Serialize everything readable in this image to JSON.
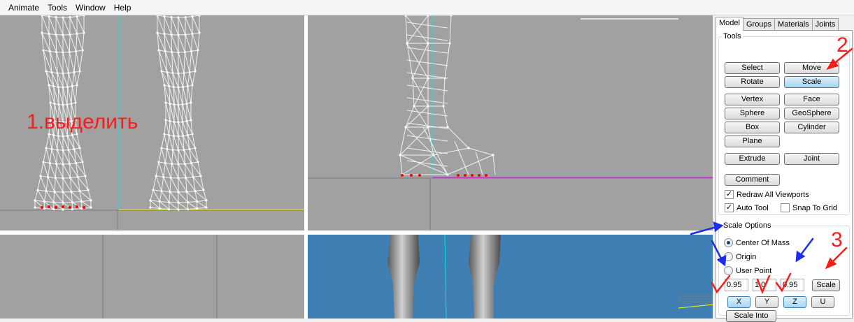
{
  "menu": {
    "items": [
      "Animate",
      "Tools",
      "Window",
      "Help"
    ]
  },
  "viewports": {
    "annotation_select": "1.выделить"
  },
  "panel": {
    "tabs": [
      "Model",
      "Groups",
      "Materials",
      "Joints"
    ],
    "active_tab": "Model",
    "tools": {
      "legend": "Tools",
      "select": "Select",
      "move": "Move",
      "rotate": "Rotate",
      "scale": "Scale",
      "vertex": "Vertex",
      "face": "Face",
      "sphere": "Sphere",
      "geosphere": "GeoSphere",
      "box": "Box",
      "cylinder": "Cylinder",
      "plane": "Plane",
      "extrude": "Extrude",
      "joint": "Joint",
      "comment": "Comment",
      "redraw_all": "Redraw All Viewports",
      "redraw_all_checked": true,
      "auto_tool": "Auto Tool",
      "auto_tool_checked": true,
      "snap_to_grid": "Snap To Grid",
      "snap_to_grid_checked": false
    },
    "scale_options": {
      "legend": "Scale Options",
      "center_of_mass": "Center Of Mass",
      "origin": "Origin",
      "user_point": "User Point",
      "selected": "Center Of Mass",
      "x_value": "0.95",
      "y_value": "1.0",
      "z_value": "0.95",
      "scale_button": "Scale",
      "x_button": "X",
      "y_button": "Y",
      "z_button": "Z",
      "u_button": "U",
      "scale_into": "Scale Into"
    }
  },
  "annotations": {
    "step2": "2",
    "step3": "3"
  },
  "colors": {
    "viewport_bg": "#a1a1a1",
    "viewport_3d_bg": "#3f7fb4",
    "wire": "#f2f2f2",
    "selected_vertex": "#ff0000",
    "axis_cyan": "#00e5e5",
    "axis_yellow": "#ffff00",
    "axis_magenta": "#ff00ff",
    "annotation_red": "#ff1a1a",
    "annotation_blue": "#1a2ef0"
  }
}
